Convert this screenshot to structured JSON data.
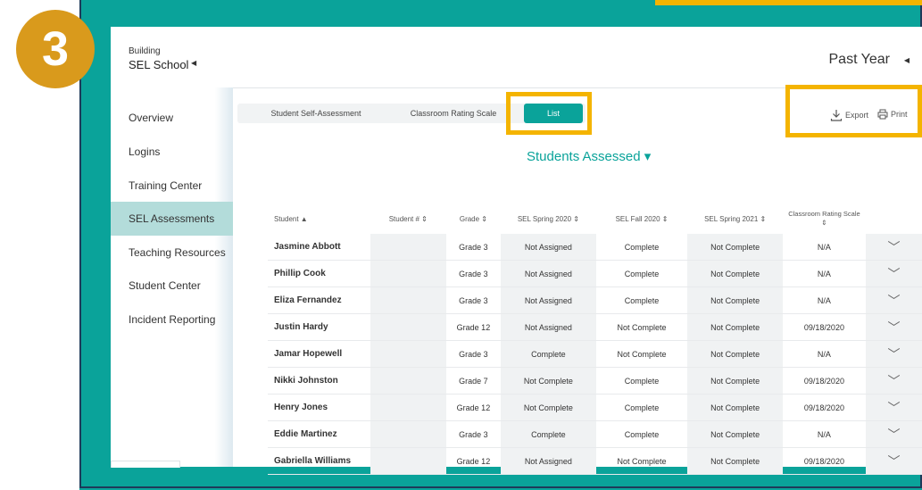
{
  "step_badge": "3",
  "building": {
    "label": "Building",
    "name": "SEL School"
  },
  "period": "Past Year",
  "sidebar": {
    "items": [
      {
        "label": "Overview"
      },
      {
        "label": "Logins"
      },
      {
        "label": "Training Center"
      },
      {
        "label": "SEL Assessments",
        "active": true
      },
      {
        "label": "Teaching Resources"
      },
      {
        "label": "Student Center"
      },
      {
        "label": "Incident Reporting"
      }
    ]
  },
  "tabs": [
    {
      "label": "Student Self-Assessment"
    },
    {
      "label": "Classroom Rating Scale"
    },
    {
      "label": "List",
      "active": true
    }
  ],
  "toolbar": {
    "export_label": "Export",
    "print_label": "Print"
  },
  "section_title": "Students Assessed ▾",
  "table": {
    "headers": [
      "Student ▲",
      "Student # ⇕",
      "Grade ⇕",
      "SEL Spring 2020 ⇕",
      "SEL Fall 2020 ⇕",
      "SEL Spring 2021 ⇕",
      "Classroom Rating Scale ⇕"
    ],
    "rows": [
      [
        "Jasmine Abbott",
        "",
        "Grade 3",
        "Not Assigned",
        "Complete",
        "Not Complete",
        "N/A"
      ],
      [
        "Phillip Cook",
        "",
        "Grade 3",
        "Not Assigned",
        "Complete",
        "Not Complete",
        "N/A"
      ],
      [
        "Eliza Fernandez",
        "",
        "Grade 3",
        "Not Assigned",
        "Complete",
        "Not Complete",
        "N/A"
      ],
      [
        "Justin Hardy",
        "",
        "Grade 12",
        "Not Assigned",
        "Not Complete",
        "Not Complete",
        "09/18/2020"
      ],
      [
        "Jamar Hopewell",
        "",
        "Grade 3",
        "Complete",
        "Not Complete",
        "Not Complete",
        "N/A"
      ],
      [
        "Nikki Johnston",
        "",
        "Grade 7",
        "Not Complete",
        "Complete",
        "Not Complete",
        "09/18/2020"
      ],
      [
        "Henry Jones",
        "",
        "Grade 12",
        "Not Complete",
        "Complete",
        "Not Complete",
        "09/18/2020"
      ],
      [
        "Eddie Martinez",
        "",
        "Grade 3",
        "Complete",
        "Complete",
        "Not Complete",
        "N/A"
      ],
      [
        "Gabriella Williams",
        "",
        "Grade 12",
        "Not Assigned",
        "Not Complete",
        "Not Complete",
        "09/18/2020"
      ]
    ]
  },
  "colors": {
    "teal": "#0aa39a",
    "highlight": "#f4b400",
    "badge": "#d99a1c",
    "active_nav": "#b3dcda"
  }
}
